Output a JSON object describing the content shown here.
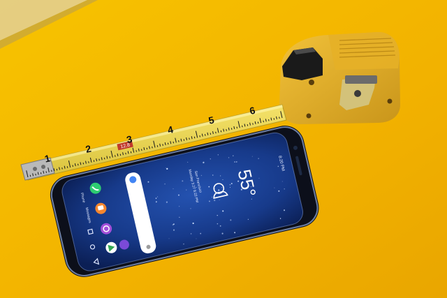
{
  "photo": {
    "tape_measure": {
      "tick_numbers": [
        "1",
        "2",
        "3",
        "4",
        "5",
        "6"
      ],
      "stud_marker": "12.8",
      "body_color": "#e8b52a"
    },
    "phone": {
      "weather_temperature": "55°",
      "weather_city": "San Francisco",
      "weather_date": "Monday 3.27 8:22 PM",
      "status_time": "8:20 PM",
      "app_labels": [
        "Phone",
        "Messages",
        "Galaxy Apps",
        "Play Store",
        "Internet"
      ],
      "screen_color": "#1b3a8a"
    },
    "background_color": "#f2b400"
  }
}
